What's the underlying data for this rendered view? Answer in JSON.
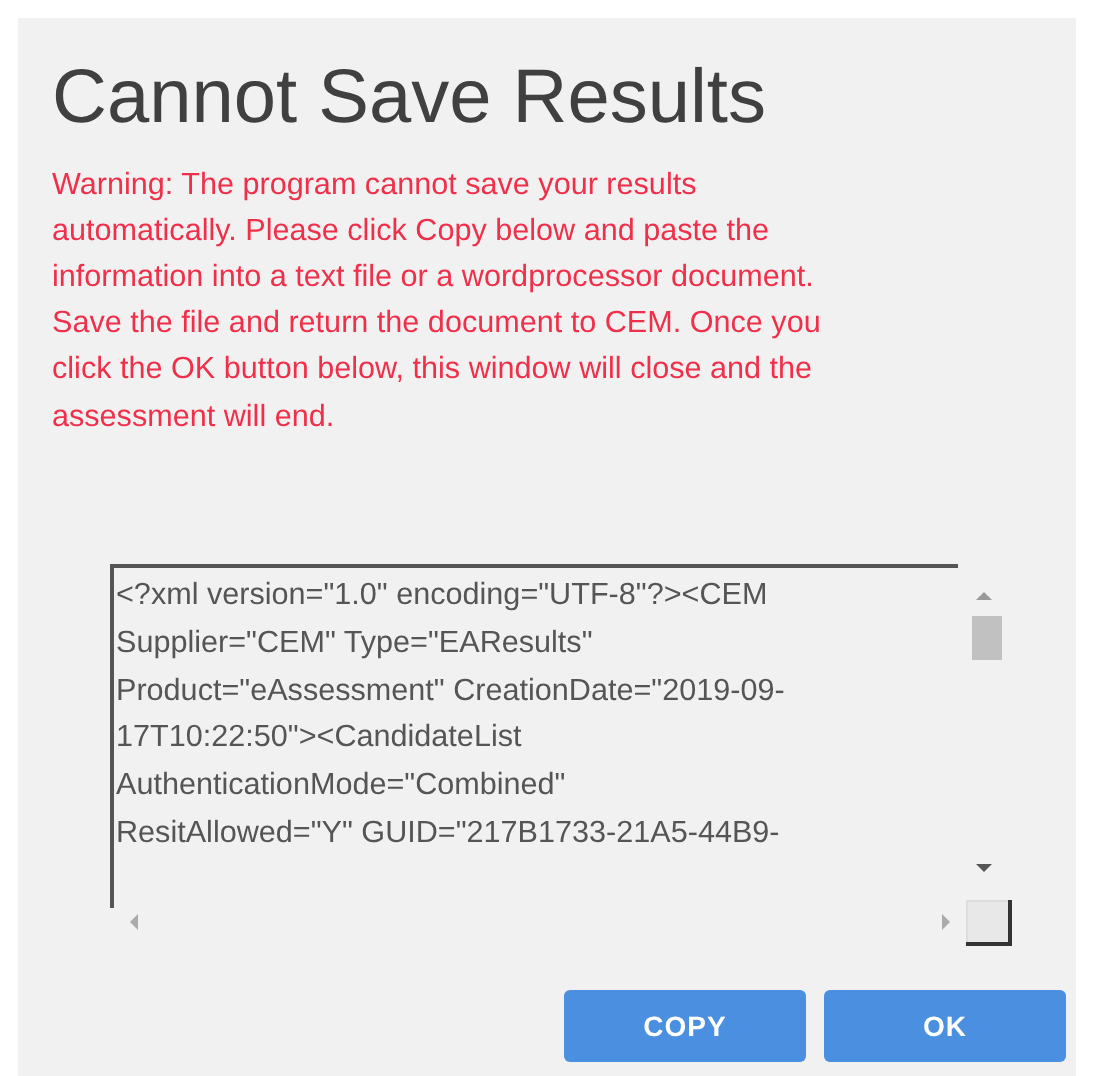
{
  "dialog": {
    "title": "Cannot Save Results",
    "warning": "Warning: The program cannot save your results\nautomatically. Please click Copy below and paste the\ninformation into a text file or a wordprocessor document.\nSave the file and return the document to CEM. Once you\nclick the OK button below, this window will close and the\nassessment will end.",
    "results_field": {
      "value": "<?xml version=\"1.0\" encoding=\"UTF-8\"?><CEM\nSupplier=\"CEM\" Type=\"EAResults\"\nProduct=\"eAssessment\" CreationDate=\"2019-09-\n17T10:22:50\"><CandidateList\nAuthenticationMode=\"Combined\"\nResitAllowed=\"Y\" GUID=\"217B1733-21A5-44B9-"
    },
    "buttons": [
      "COPY",
      "OK"
    ]
  }
}
